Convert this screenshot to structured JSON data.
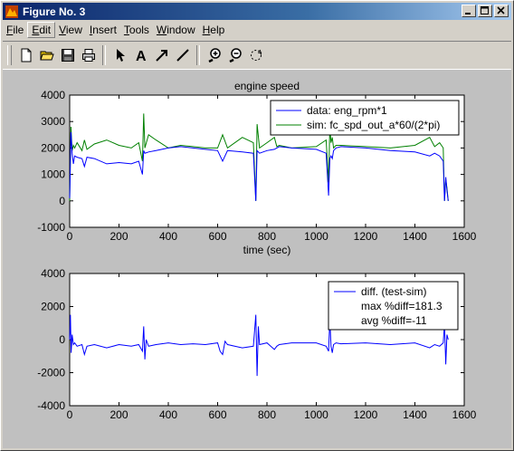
{
  "window": {
    "title": "Figure No. 3"
  },
  "menu": [
    "File",
    "Edit",
    "View",
    "Insert",
    "Tools",
    "Window",
    "Help"
  ],
  "menu_underline": [
    "F",
    "E",
    "V",
    "I",
    "T",
    "W",
    "H"
  ],
  "toolbar": [
    "new-file-icon",
    "open-folder-icon",
    "save-icon",
    "print-icon",
    "select-arrow-icon",
    "insert-text-icon",
    "insert-arrow-icon",
    "insert-line-icon",
    "zoom-in-icon",
    "zoom-out-icon",
    "rotate-icon"
  ],
  "colors": {
    "blue": "#0000ff",
    "green": "#008000",
    "title_bar": "#0a246a"
  },
  "chart_data": [
    {
      "type": "line",
      "title": "engine speed",
      "xlabel": "time (sec)",
      "ylabel": "",
      "xlim": [
        0,
        1600
      ],
      "ylim": [
        -1000,
        4000
      ],
      "xticks": [
        "0",
        "200",
        "400",
        "600",
        "800",
        "1000",
        "1200",
        "1400",
        "1600"
      ],
      "yticks": [
        "4000",
        "3000",
        "2000",
        "1000",
        "0",
        "-1000"
      ],
      "legend_position": "top-right",
      "series": [
        {
          "name": "data: eng_rpm*1",
          "color": "#0000ff",
          "x": [
            0,
            5,
            10,
            15,
            20,
            30,
            50,
            60,
            70,
            100,
            150,
            200,
            250,
            280,
            295,
            300,
            305,
            320,
            350,
            400,
            450,
            500,
            550,
            600,
            620,
            640,
            700,
            745,
            755,
            760,
            770,
            800,
            830,
            840,
            850,
            900,
            1000,
            1040,
            1050,
            1055,
            1060,
            1065,
            1070,
            1080,
            1100,
            1200,
            1300,
            1400,
            1460,
            1480,
            1500,
            1515,
            1520,
            1525,
            1530,
            1535
          ],
          "y": [
            100,
            2600,
            1800,
            1400,
            1700,
            1650,
            1600,
            1300,
            1650,
            1600,
            1400,
            1450,
            1400,
            1500,
            1000,
            1900,
            1800,
            1850,
            1900,
            2000,
            2050,
            2000,
            1950,
            1900,
            1500,
            1900,
            1850,
            1800,
            0,
            1900,
            1800,
            1900,
            1950,
            2000,
            2050,
            2000,
            1950,
            1800,
            200,
            1600,
            1700,
            1600,
            1900,
            2000,
            2050,
            2000,
            1900,
            1850,
            1700,
            1800,
            1700,
            1500,
            0,
            900,
            400,
            0
          ]
        },
        {
          "name": "sim: fc_spd_out_a*60/(2*pi)",
          "color": "#008000",
          "x": [
            0,
            5,
            10,
            15,
            20,
            30,
            50,
            60,
            70,
            100,
            150,
            200,
            250,
            280,
            295,
            300,
            305,
            320,
            350,
            400,
            450,
            500,
            550,
            600,
            620,
            640,
            700,
            745,
            755,
            760,
            770,
            800,
            830,
            840,
            850,
            900,
            1000,
            1040,
            1050,
            1055,
            1060,
            1065,
            1070,
            1080,
            1100,
            1200,
            1300,
            1400,
            1460,
            1480,
            1500,
            1515,
            1520,
            1525,
            1530,
            1535
          ],
          "y": [
            0,
            2800,
            1900,
            2100,
            2000,
            2200,
            1900,
            2300,
            1950,
            2150,
            2300,
            2100,
            2000,
            2200,
            1500,
            3300,
            2000,
            2500,
            2300,
            2000,
            2100,
            2050,
            2000,
            2000,
            2500,
            2000,
            2400,
            2200,
            0,
            2900,
            2000,
            2200,
            2400,
            2050,
            2100,
            2000,
            2050,
            2300,
            700,
            2800,
            2200,
            2400,
            2000,
            2100,
            2100,
            2050,
            2000,
            2100,
            2400,
            2050,
            2200,
            2000,
            0,
            800,
            500,
            0
          ]
        }
      ]
    },
    {
      "type": "line",
      "title": "",
      "xlabel": "",
      "ylabel": "",
      "xlim": [
        0,
        1600
      ],
      "ylim": [
        -4000,
        4000
      ],
      "xticks": [
        "0",
        "200",
        "400",
        "600",
        "800",
        "1000",
        "1200",
        "1400",
        "1600"
      ],
      "yticks": [
        "4000",
        "2000",
        "0",
        "-2000",
        "-4000"
      ],
      "legend_position": "top-right",
      "legend": [
        "diff. (test-sim)",
        "max %diff=181.3",
        "avg %diff=-11"
      ],
      "series": [
        {
          "name": "diff. (test-sim)",
          "color": "#0000ff",
          "x": [
            0,
            3,
            6,
            10,
            15,
            20,
            30,
            50,
            60,
            70,
            100,
            150,
            200,
            250,
            280,
            295,
            300,
            305,
            310,
            320,
            350,
            400,
            450,
            500,
            550,
            600,
            610,
            620,
            630,
            640,
            700,
            745,
            755,
            760,
            765,
            770,
            800,
            830,
            840,
            850,
            900,
            1000,
            1040,
            1050,
            1055,
            1060,
            1065,
            1070,
            1080,
            1100,
            1200,
            1300,
            1400,
            1460,
            1480,
            1500,
            1515,
            1520,
            1525,
            1530,
            1535
          ],
          "y": [
            0,
            1500,
            -800,
            300,
            -300,
            -200,
            -400,
            -300,
            -900,
            -400,
            -300,
            -500,
            -300,
            -400,
            -300,
            -700,
            800,
            -1200,
            0,
            -400,
            -300,
            -200,
            -300,
            -250,
            -300,
            -200,
            -700,
            -900,
            -100,
            -300,
            -500,
            -400,
            1500,
            -2200,
            800,
            -300,
            -200,
            -600,
            -400,
            -300,
            -200,
            -200,
            -400,
            -700,
            1200,
            -400,
            -800,
            -300,
            -200,
            -250,
            -200,
            -300,
            -200,
            -500,
            -300,
            -400,
            -200,
            1000,
            -1500,
            300,
            0
          ]
        }
      ]
    }
  ]
}
